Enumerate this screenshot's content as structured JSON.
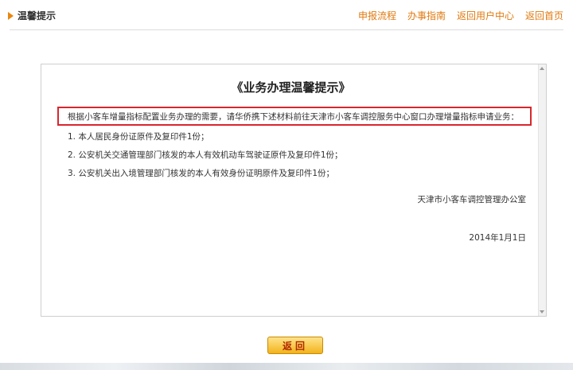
{
  "header": {
    "title": "温馨提示",
    "nav": [
      {
        "label": "申报流程"
      },
      {
        "label": "办事指南"
      },
      {
        "label": "返回用户中心"
      },
      {
        "label": "返回首页"
      }
    ]
  },
  "notice": {
    "heading": "《业务办理温馨提示》",
    "intro": "根据小客车增量指标配置业务办理的需要，请华侨携下述材料前往天津市小客车调控服务中心窗口办理增量指标申请业务：",
    "items": [
      "1. 本人居民身份证原件及复印件1份；",
      "2. 公安机关交通管理部门核发的本人有效机动车驾驶证原件及复印件1份；",
      "3. 公安机关出入境管理部门核发的本人有效身份证明原件及复印件1份；"
    ],
    "signature": "天津市小客车调控管理办公室",
    "date": "2014年1月1日"
  },
  "actions": {
    "back_label": "返回"
  },
  "colors": {
    "accent": "#e07a10",
    "highlight_border": "#d9262d",
    "button_gradient_top": "#ffe38a",
    "button_gradient_bottom": "#f2b31d"
  }
}
